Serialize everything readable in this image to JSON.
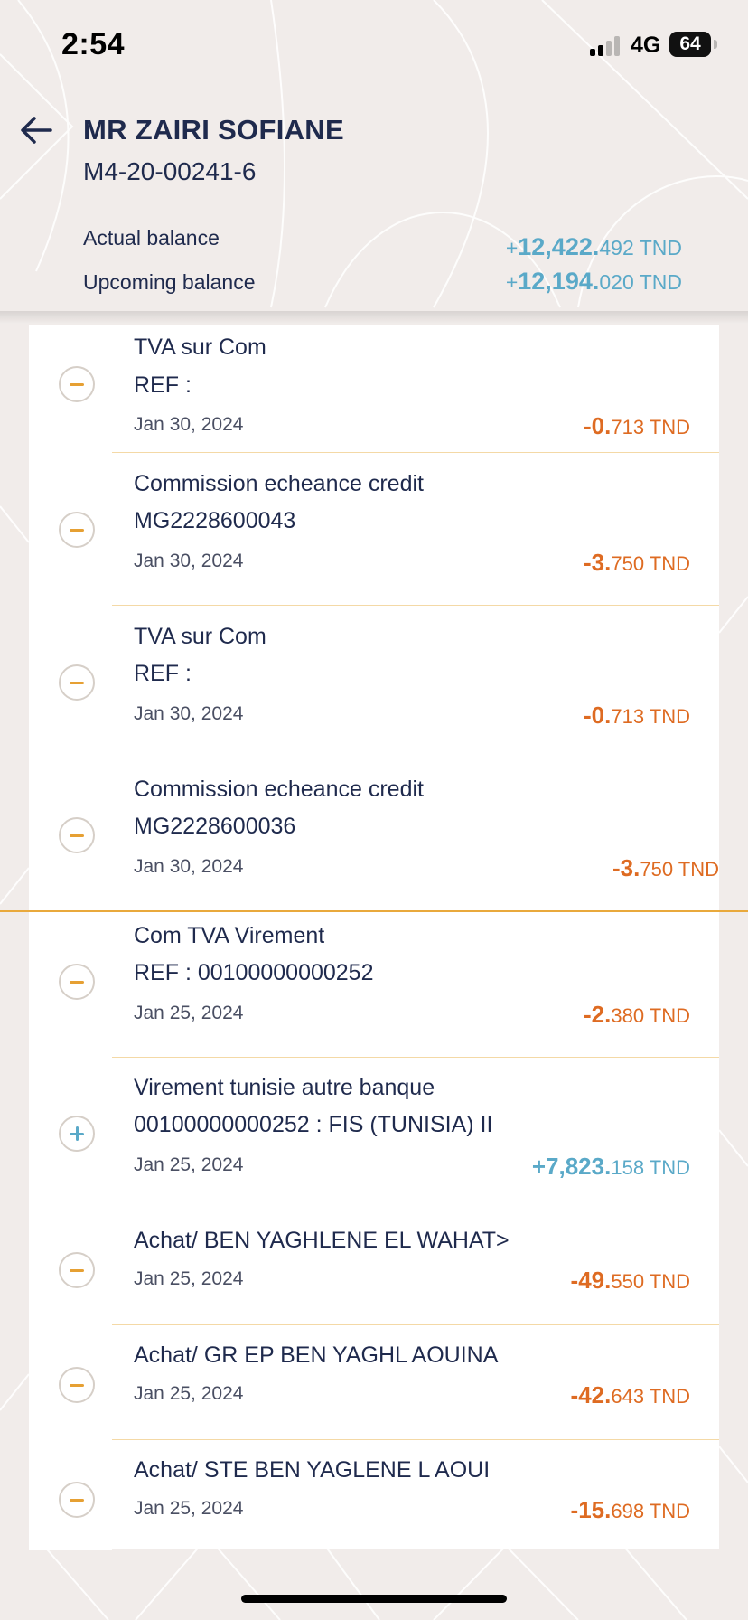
{
  "status_bar": {
    "time": "2:54",
    "network": "4G",
    "battery": "64"
  },
  "header": {
    "back_icon": "arrow-left-icon",
    "account_name": "MR ZAIRI SOFIANE",
    "account_number": "M4-20-00241-6",
    "actual_balance_label": "Actual balance",
    "actual_balance": {
      "sign": "+",
      "int": "12,422.",
      "dec": "492",
      "currency": "TND"
    },
    "upcoming_balance_label": "Upcoming balance",
    "upcoming_balance": {
      "sign": "+",
      "int": "12,194.",
      "dec": "020",
      "currency": "TND"
    }
  },
  "colors": {
    "debit": "#de6b22",
    "credit": "#5aa9c8",
    "accent": "#e9a93c",
    "text": "#1f2a4d",
    "background": "#f1ecea"
  },
  "transactions": [
    {
      "type": "debit",
      "icon": "minus-circle-icon",
      "title": "TVA sur Com",
      "ref": "REF :",
      "date": "Jan 30, 2024",
      "amount_int": "-0.",
      "amount_dec": "713",
      "currency": "TND"
    },
    {
      "type": "debit",
      "icon": "minus-circle-icon",
      "title": "Commission echeance credit",
      "ref": "MG2228600043",
      "date": "Jan 30, 2024",
      "amount_int": "-3.",
      "amount_dec": "750",
      "currency": "TND"
    },
    {
      "type": "debit",
      "icon": "minus-circle-icon",
      "title": "TVA sur Com",
      "ref": "REF :",
      "date": "Jan 30, 2024",
      "amount_int": "-0.",
      "amount_dec": "713",
      "currency": "TND"
    },
    {
      "type": "debit",
      "icon": "minus-circle-icon",
      "title": "Commission echeance credit",
      "ref": "MG2228600036",
      "date": "Jan 30, 2024",
      "amount_int": "-3.",
      "amount_dec": "750",
      "currency": "TND"
    },
    {
      "type": "debit",
      "icon": "minus-circle-icon",
      "title": "Com TVA Virement",
      "ref": "REF : 00100000000252",
      "date": "Jan 25, 2024",
      "amount_int": "-2.",
      "amount_dec": "380",
      "currency": "TND"
    },
    {
      "type": "credit",
      "icon": "plus-circle-icon",
      "title": "Virement tunisie autre banque",
      "ref": "00100000000252 : FIS (TUNISIA) II",
      "date": "Jan 25, 2024",
      "amount_int": "+7,823.",
      "amount_dec": "158",
      "currency": "TND"
    },
    {
      "type": "debit",
      "icon": "minus-circle-icon",
      "title": "Achat/ BEN YAGHLENE EL WAHAT>",
      "ref": "",
      "date": "Jan 25, 2024",
      "amount_int": "-49.",
      "amount_dec": "550",
      "currency": "TND"
    },
    {
      "type": "debit",
      "icon": "minus-circle-icon",
      "title": "Achat/ GR EP BEN YAGHL AOUINA",
      "ref": "",
      "date": "Jan 25, 2024",
      "amount_int": "-42.",
      "amount_dec": "643",
      "currency": "TND"
    },
    {
      "type": "debit",
      "icon": "minus-circle-icon",
      "title": "Achat/ STE BEN YAGLENE L AOUI",
      "ref": "",
      "date": "Jan 25, 2024",
      "amount_int": "-15.",
      "amount_dec": "698",
      "currency": "TND"
    }
  ]
}
